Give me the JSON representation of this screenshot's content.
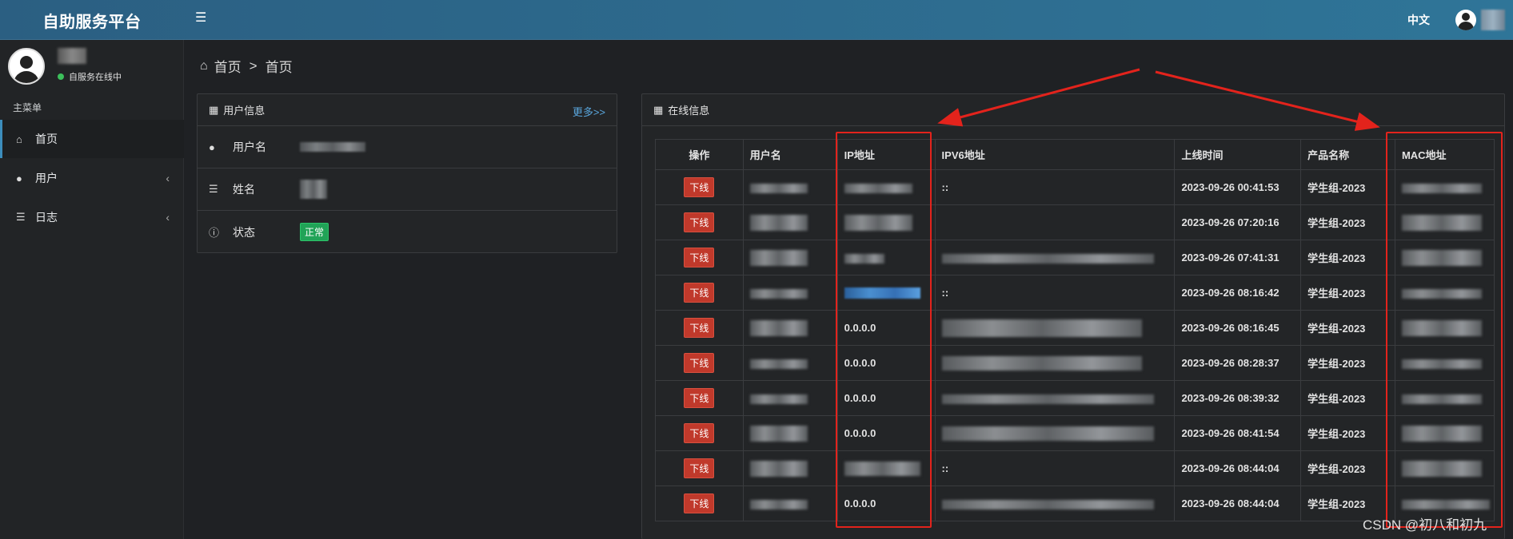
{
  "header": {
    "brand": "自助服务平台",
    "language": "中文",
    "menu_icon": "hamburger-icon"
  },
  "sidebar": {
    "status": "自服务在线中",
    "menu_header": "主菜单",
    "items": [
      {
        "label": "首页",
        "icon": "home-icon"
      },
      {
        "label": "用户",
        "icon": "user-icon"
      },
      {
        "label": "日志",
        "icon": "list-icon"
      }
    ]
  },
  "breadcrumb": {
    "home": "首页",
    "current": "首页"
  },
  "user_panel": {
    "title": "用户信息",
    "more": "更多>>",
    "rows": [
      {
        "label": "用户名"
      },
      {
        "label": "姓名"
      },
      {
        "label": "状态",
        "value": "正常"
      }
    ]
  },
  "online_panel": {
    "title": "在线信息",
    "columns": [
      "操作",
      "用户名",
      "IP地址",
      "IPV6地址",
      "上线时间",
      "产品名称",
      "MAC地址"
    ],
    "action_label": "下线",
    "rows": [
      {
        "ip": "",
        "ipv6": "::",
        "time": "2023-09-26 00:41:53",
        "product": "学生组-2023"
      },
      {
        "ip": "",
        "ipv6": "",
        "time": "2023-09-26 07:20:16",
        "product": "学生组-2023"
      },
      {
        "ip": "",
        "ipv6": "",
        "time": "2023-09-26 07:41:31",
        "product": "学生组-2023"
      },
      {
        "ip": "",
        "ipv6": "::",
        "time": "2023-09-26 08:16:42",
        "product": "学生组-2023"
      },
      {
        "ip": "0.0.0.0",
        "ipv6": "",
        "time": "2023-09-26 08:16:45",
        "product": "学生组-2023"
      },
      {
        "ip": "0.0.0.0",
        "ipv6": "",
        "time": "2023-09-26 08:28:37",
        "product": "学生组-2023"
      },
      {
        "ip": "0.0.0.0",
        "ipv6": "",
        "time": "2023-09-26 08:39:32",
        "product": "学生组-2023"
      },
      {
        "ip": "0.0.0.0",
        "ipv6": "",
        "time": "2023-09-26 08:41:54",
        "product": "学生组-2023"
      },
      {
        "ip": "",
        "ipv6": "::",
        "time": "2023-09-26 08:44:04",
        "product": "学生组-2023"
      },
      {
        "ip": "0.0.0.0",
        "ipv6": "",
        "time": "2023-09-26 08:44:04",
        "product": "学生组-2023"
      }
    ]
  },
  "watermark": "CSDN @初八和初九",
  "colors": {
    "header": "#2f7598",
    "danger": "#c0392b",
    "success": "#21a357",
    "annotation": "#e3231c",
    "link": "#5aa7de"
  }
}
